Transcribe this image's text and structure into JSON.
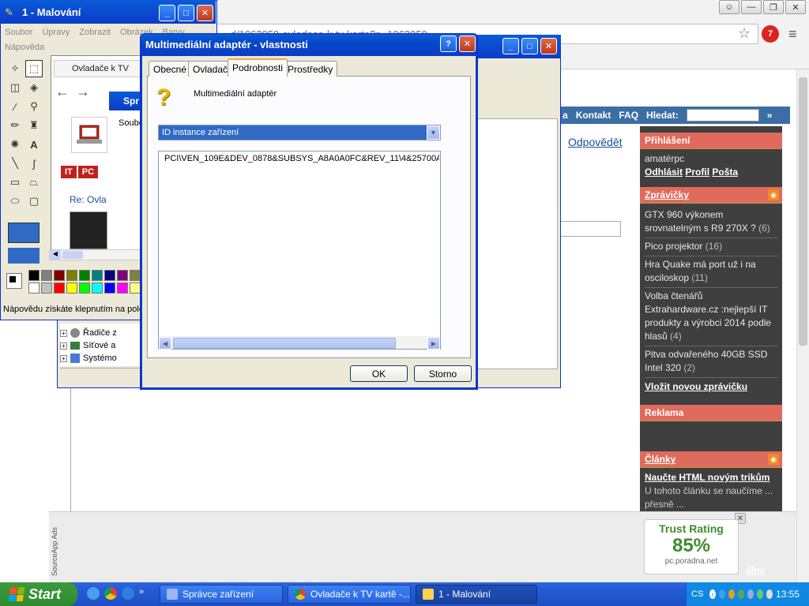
{
  "chrome": {
    "url": "...d/1062059-ovladace-k-tv-karte?p=1062059",
    "nav": [
      "a",
      "Kontakt",
      "FAQ"
    ],
    "search_label": "Hledat:",
    "reply": "Odpovědět",
    "sidebar": {
      "login": {
        "title": "Přihlášení",
        "user": "amatérpc",
        "links": [
          "Odhlásit",
          "Profil",
          "Pošta"
        ]
      },
      "news": {
        "title": "Zprávičky",
        "items": [
          {
            "text": "GTX 960 výkonem srovnatelným s R9 270X ?",
            "count": "(6)"
          },
          {
            "text": "Pico projektor",
            "count": "(16)"
          },
          {
            "text": "Hra Quake má port už i na osciloskop",
            "count": "(11)"
          },
          {
            "text": "Volba čtenářů Extrahardware.cz :nejlepší IT produkty a výrobci 2014 podle hlasů",
            "count": "(4)"
          },
          {
            "text": "Pitva odvařeného 40GB SSD Intel 320",
            "count": "(2)"
          }
        ],
        "add_link": "Vložit novou zprávičku"
      },
      "ads": {
        "title": "Reklama"
      },
      "articles": {
        "title": "Články",
        "link": "Naučte HTML novým trikům",
        "snippet": "U tohoto článku se naučíme ... přesně ...",
        "bottom_link": "álny"
      }
    },
    "ad": {
      "vertical": "SourceApp Ads",
      "trust_title": "Trust Rating",
      "trust_value": "85%",
      "trust_url": "pc.poradna.net"
    }
  },
  "paint": {
    "title": "1 - Malování",
    "menu": [
      "Soubor",
      "Úpravy",
      "Zobrazit",
      "Obrázek",
      "Barvy",
      "Nápověda"
    ],
    "status": "Nápovědu získáte klepnutím na polo",
    "canvas": {
      "tab": "Ovladače k TV",
      "tags": [
        "IT",
        "PC"
      ],
      "re": "Re: Ovla",
      "devmgr_title": "Spr",
      "devmgr_menu": "Soubo"
    },
    "palette": [
      "#000000",
      "#808080",
      "#800000",
      "#808000",
      "#008000",
      "#008080",
      "#000080",
      "#800080",
      "#808040",
      "#ffffff",
      "#c0c0c0",
      "#ff0000",
      "#ffff00",
      "#00ff00",
      "#00ffff",
      "#0000ff",
      "#ff00ff",
      "#ffff80"
    ]
  },
  "devmgr": {
    "rows": [
      "Řadiče z",
      "Síťové a",
      "Systémo"
    ]
  },
  "dialog": {
    "title": "Multimediální adaptér - vlastnosti",
    "help": "?",
    "tabs": [
      "Obecné",
      "Ovladač",
      "Podrobnosti",
      "Prostředky"
    ],
    "active_tab": "Podrobnosti",
    "device_name": "Multimediální adaptér",
    "property": "ID instance zařízení",
    "value": "PCI\\VEN_109E&DEV_0878&SUBSYS_A8A0A0FC&REV_11\\4&25700A26",
    "ok": "OK",
    "cancel": "Storno"
  },
  "taskbar": {
    "start": "Start",
    "tasks": [
      {
        "label": "Správce zařízení",
        "active": false
      },
      {
        "label": "Ovladače k TV kartě -...",
        "active": false
      },
      {
        "label": "1 - Malování",
        "active": true
      }
    ],
    "lang": "CS",
    "clock": "13:55"
  }
}
